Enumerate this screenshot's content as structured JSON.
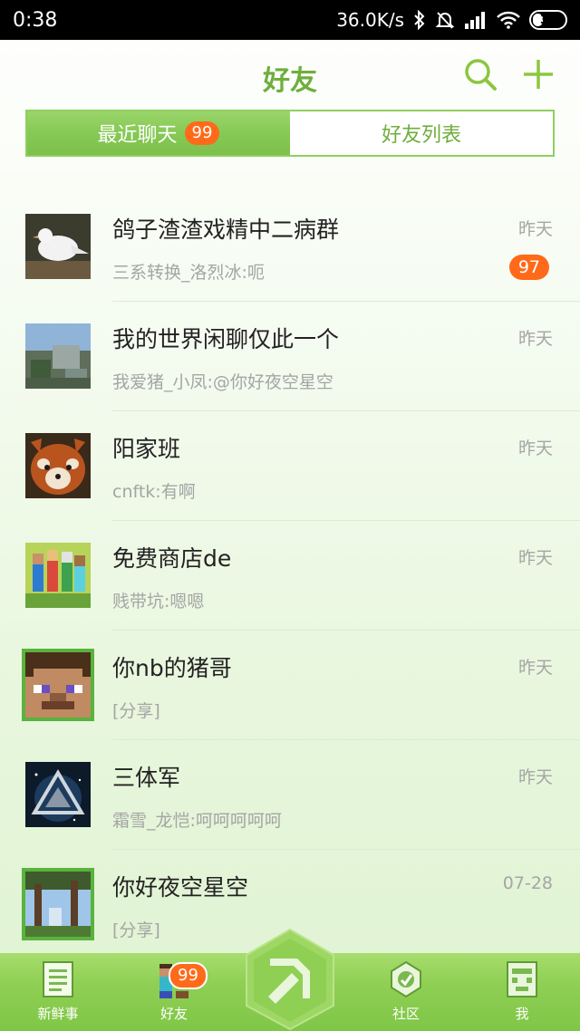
{
  "status_bar": {
    "time": "0:38",
    "network_speed": "36.0K/s",
    "battery": "33",
    "battery_level": 0.33
  },
  "header": {
    "title": "好友"
  },
  "tabs": {
    "recent_chats": "最近聊天",
    "recent_badge": "99",
    "friend_list": "好友列表"
  },
  "chats": [
    {
      "name": "鸽子渣渣戏精中二病群",
      "preview": "三系转换_洛烈冰:呃",
      "time": "昨天",
      "unread": "97"
    },
    {
      "name": "我的世界闲聊仅此一个",
      "preview": "我爱猪_小凤:@你好夜空星空",
      "time": "昨天"
    },
    {
      "name": "阳家班",
      "preview": "cnftk:有啊",
      "time": "昨天"
    },
    {
      "name": "免费商店de",
      "preview": "贱带坑:嗯嗯",
      "time": "昨天"
    },
    {
      "name": "你nb的猪哥",
      "preview": "[分享]",
      "time": "昨天"
    },
    {
      "name": "三体军",
      "preview": "霜雪_龙恺:呵呵呵呵呵",
      "time": "昨天"
    },
    {
      "name": "你好夜空星空",
      "preview": "[分享]",
      "time": "07-28"
    }
  ],
  "bottom_nav": {
    "news": "新鲜事",
    "friends": "好友",
    "friends_badge": "99",
    "community": "社区",
    "me": "我"
  },
  "colors": {
    "accent_green": "#6fae3c",
    "badge_orange": "#ff6a1a"
  }
}
